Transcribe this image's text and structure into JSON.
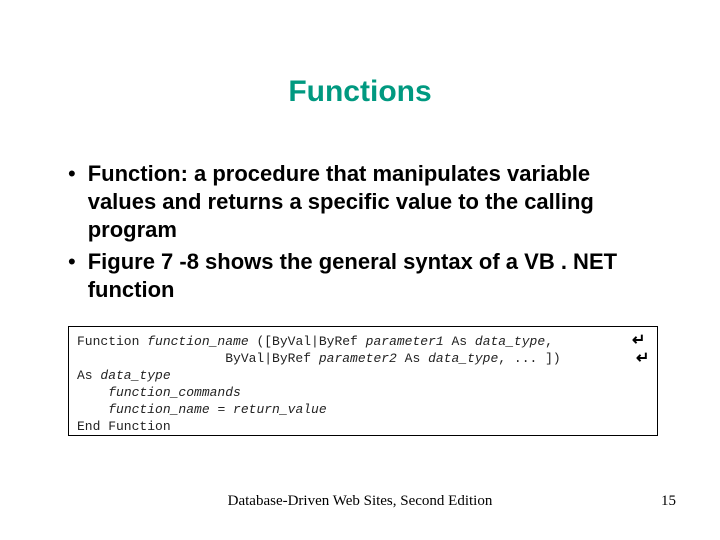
{
  "title": "Functions",
  "bullets": [
    "Function: a procedure that manipulates variable values and returns a specific value to the calling program",
    "Figure 7 -8 shows the general syntax of a VB . NET function"
  ],
  "code": {
    "l1a": "Function ",
    "l1b": "function_name",
    "l1c": " ([ByVal|ByRef ",
    "l1d": "parameter1",
    "l1e": " As ",
    "l1f": "data_type",
    "l1g": ", ",
    "l2a": "                   ByVal|ByRef ",
    "l2b": "parameter2",
    "l2c": " As ",
    "l2d": "data_type",
    "l2e": ", ... ]) ",
    "l3a": "As ",
    "l3b": "data_type",
    "l4a": "    ",
    "l4b": "function_commands",
    "l5a": "    ",
    "l5b": "function_name",
    "l5c": " = ",
    "l5d": "return_value",
    "l6a": "End Function"
  },
  "return_glyph": "↵",
  "footer": {
    "center": "Database-Driven Web Sites, Second Edition",
    "page": "15"
  }
}
